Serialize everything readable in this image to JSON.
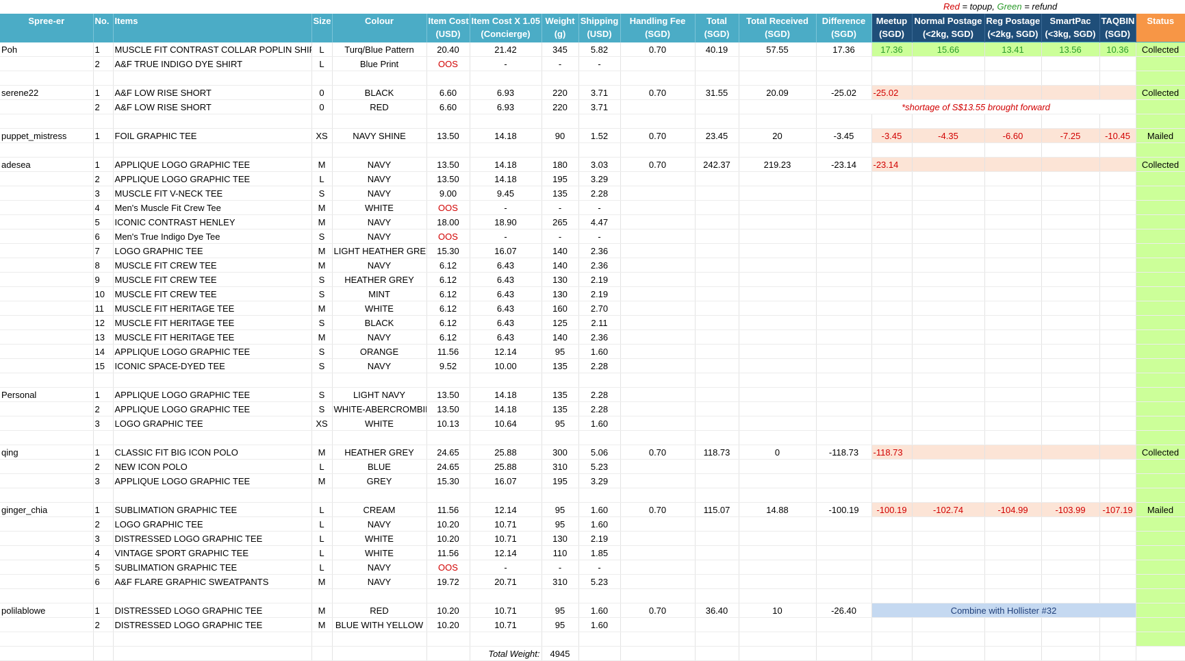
{
  "legend": {
    "red_word": "Red",
    "red_text": " = topup,",
    "green_word": "Green",
    "green_text": " = refund"
  },
  "headers": {
    "spreeer": "Spree-er",
    "no": "No.",
    "items": "Items",
    "size": "Size",
    "colour": "Colour",
    "item_cost_1": "Item Cost",
    "item_cost_2": "(USD)",
    "concierge_1": "Item Cost X 1.05",
    "concierge_2": "(Concierge)",
    "weight_1": "Weight",
    "weight_2": "(g)",
    "shipping_1": "Shipping",
    "shipping_2": "(USD)",
    "handling_1": "Handling Fee",
    "handling_2": "(SGD)",
    "total_1": "Total",
    "total_2": "(SGD)",
    "received_1": "Total Received",
    "received_2": "(SGD)",
    "difference_1": "Difference",
    "difference_2": "(SGD)",
    "meetup_1": "Meetup",
    "meetup_2": "(SGD)",
    "normal_1": "Normal Postage",
    "normal_2": "(<2kg, SGD)",
    "reg_1": "Reg Postage",
    "reg_2": "(<2kg, SGD)",
    "smartpac_1": "SmartPac",
    "smartpac_2": "(<3kg, SGD)",
    "taqbin_1": "TAQBIN",
    "taqbin_2": "(SGD)",
    "status": "Status"
  },
  "rows": [
    {
      "spreeer": "Poh",
      "no": "1",
      "item": "MUSCLE FIT CONTRAST COLLAR POPLIN SHIRT",
      "size": "L",
      "colour": "Turq/Blue Pattern",
      "cost": "20.40",
      "concierge": "21.42",
      "weight": "345",
      "shipping": "5.82",
      "handling": "0.70",
      "total": "40.19",
      "received": "57.55",
      "difference": "17.36",
      "meetup": "17.36",
      "normal": "15.66",
      "reg": "13.41",
      "smartpac": "13.56",
      "taqbin": "10.36",
      "status": "Collected"
    },
    {
      "spreeer": "",
      "no": "2",
      "item": "A&F TRUE INDIGO DYE SHIRT",
      "size": "L",
      "colour": "Blue Print",
      "cost": "OOS",
      "concierge": "-",
      "weight": "-",
      "shipping": "-"
    },
    {},
    {
      "spreeer": "serene22",
      "no": "1",
      "item": "A&F LOW RISE SHORT",
      "size": "0",
      "colour": "BLACK",
      "cost": "6.60",
      "concierge": "6.93",
      "weight": "220",
      "shipping": "3.71",
      "handling": "0.70",
      "total": "31.55",
      "received": "20.09",
      "difference": "-25.02",
      "meetup": "-25.02",
      "status": "Collected"
    },
    {
      "spreeer": "",
      "no": "2",
      "item": "A&F LOW RISE SHORT",
      "size": "0",
      "colour": "RED",
      "cost": "6.60",
      "concierge": "6.93",
      "weight": "220",
      "shipping": "3.71",
      "note": "*shortage of S$13.55 brought forward"
    },
    {},
    {
      "spreeer": "puppet_mistress",
      "no": "1",
      "item": "FOIL GRAPHIC TEE",
      "size": "XS",
      "colour": "NAVY SHINE",
      "cost": "13.50",
      "concierge": "14.18",
      "weight": "90",
      "shipping": "1.52",
      "handling": "0.70",
      "total": "23.45",
      "received": "20",
      "difference": "-3.45",
      "meetup": "-3.45",
      "normal": "-4.35",
      "reg": "-6.60",
      "smartpac": "-7.25",
      "taqbin": "-10.45",
      "status": "Mailed"
    },
    {},
    {
      "spreeer": "adesea",
      "no": "1",
      "item": " APPLIQUE LOGO GRAPHIC TEE",
      "size": "M",
      "colour": "NAVY",
      "cost": "13.50",
      "concierge": "14.18",
      "weight": "180",
      "shipping": "3.03",
      "handling": "0.70",
      "total": "242.37",
      "received": "219.23",
      "difference": "-23.14",
      "meetup": "-23.14",
      "status": "Collected"
    },
    {
      "spreeer": "",
      "no": "2",
      "item": " APPLIQUE LOGO GRAPHIC TEE",
      "size": "L",
      "colour": "NAVY",
      "cost": "13.50",
      "concierge": "14.18",
      "weight": "195",
      "shipping": "3.29"
    },
    {
      "spreeer": "",
      "no": "3",
      "item": " MUSCLE FIT V-NECK TEE",
      "size": "S",
      "colour": "NAVY",
      "cost": "9.00",
      "concierge": "9.45",
      "weight": "135",
      "shipping": "2.28"
    },
    {
      "spreeer": "",
      "no": "4",
      "item": "Men's Muscle Fit Crew Tee",
      "size": "M",
      "colour": "WHITE",
      "cost": "OOS",
      "concierge": "-",
      "weight": "-",
      "shipping": "-"
    },
    {
      "spreeer": "",
      "no": "5",
      "item": "ICONIC CONTRAST HENLEY",
      "size": "M",
      "colour": "NAVY",
      "cost": "18.00",
      "concierge": "18.90",
      "weight": "265",
      "shipping": "4.47"
    },
    {
      "spreeer": "",
      "no": "6",
      "item": "Men's True Indigo Dye Tee",
      "size": "S",
      "colour": "NAVY",
      "cost": "OOS",
      "concierge": "-",
      "weight": "-",
      "shipping": "-"
    },
    {
      "spreeer": "",
      "no": "7",
      "item": "LOGO GRAPHIC TEE",
      "size": "M",
      "colour": "LIGHT HEATHER GREY",
      "cost": "15.30",
      "concierge": "16.07",
      "weight": "140",
      "shipping": "2.36"
    },
    {
      "spreeer": "",
      "no": "8",
      "item": "MUSCLE FIT CREW TEE",
      "size": "M",
      "colour": "NAVY",
      "cost": "6.12",
      "concierge": "6.43",
      "weight": "140",
      "shipping": "2.36"
    },
    {
      "spreeer": "",
      "no": "9",
      "item": "MUSCLE FIT CREW TEE",
      "size": "S",
      "colour": "HEATHER GREY",
      "cost": "6.12",
      "concierge": "6.43",
      "weight": "130",
      "shipping": "2.19"
    },
    {
      "spreeer": "",
      "no": "10",
      "item": "MUSCLE FIT CREW TEE",
      "size": "S",
      "colour": "MINT",
      "cost": "6.12",
      "concierge": "6.43",
      "weight": "130",
      "shipping": "2.19"
    },
    {
      "spreeer": "",
      "no": "11",
      "item": "MUSCLE FIT HERITAGE TEE",
      "size": "M",
      "colour": "WHITE",
      "cost": "6.12",
      "concierge": "6.43",
      "weight": "160",
      "shipping": "2.70"
    },
    {
      "spreeer": "",
      "no": "12",
      "item": "MUSCLE FIT HERITAGE TEE",
      "size": "S",
      "colour": "BLACK",
      "cost": "6.12",
      "concierge": "6.43",
      "weight": "125",
      "shipping": "2.11"
    },
    {
      "spreeer": "",
      "no": "13",
      "item": "MUSCLE FIT HERITAGE TEE",
      "size": "M",
      "colour": "NAVY",
      "cost": "6.12",
      "concierge": "6.43",
      "weight": "140",
      "shipping": "2.36"
    },
    {
      "spreeer": "",
      "no": "14",
      "item": "APPLIQUE LOGO GRAPHIC TEE",
      "size": "S",
      "colour": "ORANGE",
      "cost": "11.56",
      "concierge": "12.14",
      "weight": "95",
      "shipping": "1.60"
    },
    {
      "spreeer": "",
      "no": "15",
      "item": "ICONIC SPACE-DYED TEE",
      "size": "S",
      "colour": "NAVY",
      "cost": "9.52",
      "concierge": "10.00",
      "weight": "135",
      "shipping": "2.28"
    },
    {},
    {
      "spreeer": "Personal",
      "no": "1",
      "item": "APPLIQUE LOGO GRAPHIC TEE",
      "size": "S",
      "colour": "LIGHT NAVY",
      "cost": "13.50",
      "concierge": "14.18",
      "weight": "135",
      "shipping": "2.28"
    },
    {
      "spreeer": "",
      "no": "2",
      "item": "APPLIQUE LOGO GRAPHIC TEE",
      "size": "S",
      "colour": "WHITE-ABERCROMBIE",
      "cost": "13.50",
      "concierge": "14.18",
      "weight": "135",
      "shipping": "2.28"
    },
    {
      "spreeer": "",
      "no": "3",
      "item": " LOGO GRAPHIC TEE",
      "size": "XS",
      "colour": "WHITE",
      "cost": "10.13",
      "concierge": "10.64",
      "weight": "95",
      "shipping": "1.60"
    },
    {},
    {
      "spreeer": "qing",
      "no": "1",
      "item": "CLASSIC FIT BIG ICON POLO",
      "size": "M",
      "colour": "HEATHER GREY",
      "cost": "24.65",
      "concierge": "25.88",
      "weight": "300",
      "shipping": "5.06",
      "handling": "0.70",
      "total": "118.73",
      "received": "0",
      "difference": "-118.73",
      "meetup": "-118.73",
      "status": "Collected"
    },
    {
      "spreeer": "",
      "no": "2",
      "item": "NEW ICON POLO",
      "size": "L",
      "colour": "BLUE",
      "cost": "24.65",
      "concierge": "25.88",
      "weight": "310",
      "shipping": "5.23"
    },
    {
      "spreeer": "",
      "no": "3",
      "item": "APPLIQUE LOGO GRAPHIC TEE",
      "size": "M",
      "colour": "GREY",
      "cost": "15.30",
      "concierge": "16.07",
      "weight": "195",
      "shipping": "3.29"
    },
    {},
    {
      "spreeer": "ginger_chia",
      "no": "1",
      "item": "SUBLIMATION GRAPHIC TEE",
      "size": "L",
      "colour": "CREAM",
      "cost": "11.56",
      "concierge": "12.14",
      "weight": "95",
      "shipping": "1.60",
      "handling": "0.70",
      "total": "115.07",
      "received": "14.88",
      "difference": "-100.19",
      "meetup": "-100.19",
      "normal": "-102.74",
      "reg": "-104.99",
      "smartpac": "-103.99",
      "taqbin": "-107.19",
      "status": "Mailed"
    },
    {
      "spreeer": "",
      "no": "2",
      "item": "LOGO GRAPHIC TEE",
      "size": "L",
      "colour": "NAVY",
      "cost": "10.20",
      "concierge": "10.71",
      "weight": "95",
      "shipping": "1.60"
    },
    {
      "spreeer": "",
      "no": "3",
      "item": "DISTRESSED LOGO GRAPHIC TEE",
      "size": "L",
      "colour": "WHITE",
      "cost": "10.20",
      "concierge": "10.71",
      "weight": "130",
      "shipping": "2.19"
    },
    {
      "spreeer": "",
      "no": "4",
      "item": "VINTAGE SPORT GRAPHIC TEE",
      "size": "L",
      "colour": "WHITE",
      "cost": "11.56",
      "concierge": "12.14",
      "weight": "110",
      "shipping": "1.85"
    },
    {
      "spreeer": "",
      "no": "5",
      "item": "SUBLIMATION GRAPHIC TEE",
      "size": "L",
      "colour": "NAVY",
      "cost": "OOS",
      "concierge": "-",
      "weight": "-",
      "shipping": "-"
    },
    {
      "spreeer": "",
      "no": "6",
      "item": "A&F FLARE GRAPHIC SWEATPANTS",
      "size": "M",
      "colour": "NAVY",
      "cost": "19.72",
      "concierge": "20.71",
      "weight": "310",
      "shipping": "5.23"
    },
    {},
    {
      "spreeer": "polilablowe",
      "no": "1",
      "item": "DISTRESSED LOGO GRAPHIC TEE",
      "size": "M",
      "colour": "RED",
      "cost": "10.20",
      "concierge": "10.71",
      "weight": "95",
      "shipping": "1.60",
      "handling": "0.70",
      "total": "36.40",
      "received": "10",
      "difference": "-26.40",
      "combine": "Combine with Hollister #32"
    },
    {
      "spreeer": "",
      "no": "2",
      "item": "DISTRESSED LOGO GRAPHIC TEE",
      "size": "M",
      "colour": "BLUE WITH YELLOW",
      "cost": "10.20",
      "concierge": "10.71",
      "weight": "95",
      "shipping": "1.60"
    },
    {}
  ],
  "groups": [
    {
      "start": 0,
      "end": 2,
      "postage": "green"
    },
    {
      "start": 3,
      "end": 5,
      "postage": "red-meetup"
    },
    {
      "start": 6,
      "end": 7,
      "postage": "red"
    },
    {
      "start": 8,
      "end": 23,
      "postage": "red-meetup"
    },
    {
      "start": 24,
      "end": 27,
      "postage": "none"
    },
    {
      "start": 28,
      "end": 31,
      "postage": "red-meetup"
    },
    {
      "start": 32,
      "end": 38,
      "postage": "red"
    },
    {
      "start": 39,
      "end": 41,
      "postage": "combine"
    }
  ],
  "footer": {
    "label": "Total Weight:",
    "value": "4945"
  }
}
